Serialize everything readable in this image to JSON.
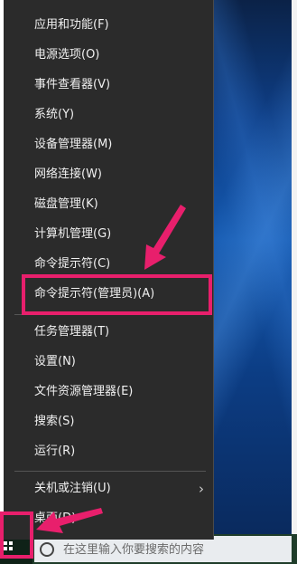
{
  "menu": {
    "items": [
      {
        "label": "应用和功能(F)"
      },
      {
        "label": "电源选项(O)"
      },
      {
        "label": "事件查看器(V)"
      },
      {
        "label": "系统(Y)"
      },
      {
        "label": "设备管理器(M)"
      },
      {
        "label": "网络连接(W)"
      },
      {
        "label": "磁盘管理(K)"
      },
      {
        "label": "计算机管理(G)"
      },
      {
        "label": "命令提示符(C)"
      },
      {
        "label": "命令提示符(管理员)(A)"
      },
      {
        "label": "任务管理器(T)"
      },
      {
        "label": "设置(N)"
      },
      {
        "label": "文件资源管理器(E)"
      },
      {
        "label": "搜索(S)"
      },
      {
        "label": "运行(R)"
      },
      {
        "label": "关机或注销(U)"
      },
      {
        "label": "桌面(D)"
      }
    ],
    "submenu_glyph": "›"
  },
  "taskbar": {
    "search_placeholder": "在这里输入你要搜索的内容"
  },
  "annotation": {
    "color": "#e81f6c"
  },
  "icons": [
    "search-icon",
    "windows-logo-icon",
    "chevron-right-icon",
    "annotation-arrow-icon"
  ]
}
